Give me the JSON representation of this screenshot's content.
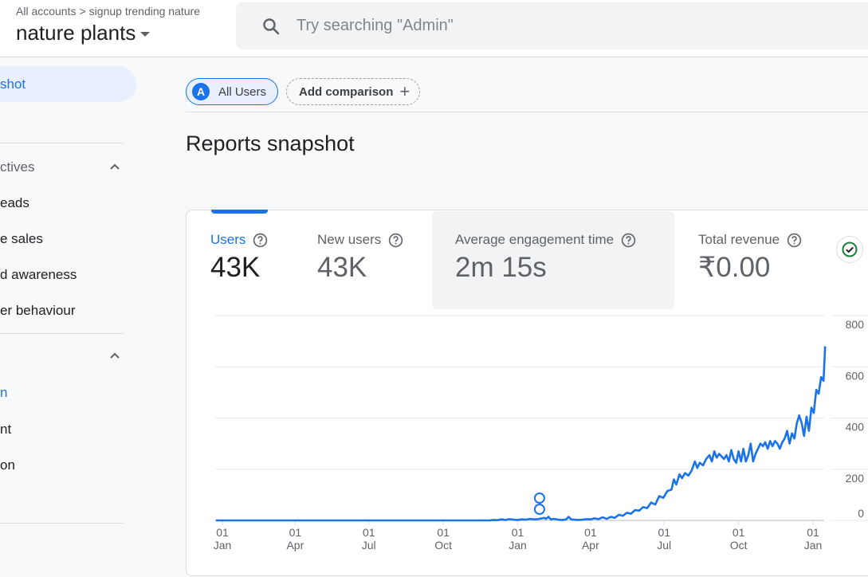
{
  "header": {
    "breadcrumb": [
      "All accounts",
      "signup trending nature"
    ],
    "breadcrumb_separator": ">",
    "property_name": "nature plants",
    "search_placeholder": "Try searching \"Admin\""
  },
  "sidebar": {
    "active_item": "shot",
    "sections": [
      {
        "title": "ctives",
        "expanded": true,
        "items": [
          "eads",
          "e sales",
          "d awareness",
          "er behaviour"
        ]
      },
      {
        "title": "",
        "expanded": true,
        "items": [
          "n",
          "nt",
          "on"
        ]
      }
    ]
  },
  "main": {
    "comparison": {
      "segment_avatar": "A",
      "segment_label": "All Users",
      "add_label": "Add comparison"
    },
    "title": "Reports snapshot",
    "metrics": [
      {
        "label": "Users",
        "value": "43K",
        "state": "active"
      },
      {
        "label": "New users",
        "value": "43K",
        "state": "normal"
      },
      {
        "label": "Average engagement time",
        "value": "2m 15s",
        "state": "hover"
      },
      {
        "label": "Total revenue",
        "value": "₹0.00",
        "state": "normal"
      }
    ],
    "colors": {
      "accent": "#1a73e8",
      "check": "#188038"
    }
  },
  "chart_data": {
    "type": "line",
    "title": "",
    "xlabel": "",
    "ylabel": "Users",
    "ylim": [
      0,
      800
    ],
    "y_ticks": [
      "800",
      "600",
      "400",
      "200",
      "0"
    ],
    "y_tick_values": [
      800,
      600,
      400,
      200,
      0
    ],
    "x_ticks": [
      {
        "day": "01",
        "month": "Jan",
        "day_index": 0
      },
      {
        "day": "01",
        "month": "Apr",
        "day_index": 90
      },
      {
        "day": "01",
        "month": "Jul",
        "day_index": 181
      },
      {
        "day": "01",
        "month": "Oct",
        "day_index": 273
      },
      {
        "day": "01",
        "month": "Jan",
        "day_index": 365
      },
      {
        "day": "01",
        "month": "Apr",
        "day_index": 455
      },
      {
        "day": "01",
        "month": "Jul",
        "day_index": 546
      },
      {
        "day": "01",
        "month": "Oct",
        "day_index": 638
      },
      {
        "day": "01",
        "month": "Jan",
        "day_index": 730
      }
    ],
    "x_range_days": [
      -8,
      750
    ],
    "grid": true,
    "series": [
      {
        "name": "Users",
        "color": "#1a73e8",
        "points_day_value": [
          [
            -8,
            0
          ],
          [
            0,
            0
          ],
          [
            30,
            0
          ],
          [
            60,
            0
          ],
          [
            90,
            0
          ],
          [
            120,
            0
          ],
          [
            150,
            0
          ],
          [
            181,
            0
          ],
          [
            210,
            0
          ],
          [
            240,
            0
          ],
          [
            273,
            0
          ],
          [
            300,
            0
          ],
          [
            330,
            0
          ],
          [
            335,
            2
          ],
          [
            340,
            1
          ],
          [
            345,
            4
          ],
          [
            350,
            2
          ],
          [
            355,
            5
          ],
          [
            360,
            3
          ],
          [
            365,
            2
          ],
          [
            370,
            4
          ],
          [
            375,
            3
          ],
          [
            380,
            6
          ],
          [
            385,
            4
          ],
          [
            390,
            5
          ],
          [
            395,
            8
          ],
          [
            398,
            10
          ],
          [
            400,
            6
          ],
          [
            403,
            14
          ],
          [
            406,
            4
          ],
          [
            410,
            6
          ],
          [
            415,
            3
          ],
          [
            420,
            2
          ],
          [
            425,
            4
          ],
          [
            428,
            14
          ],
          [
            431,
            4
          ],
          [
            435,
            3
          ],
          [
            440,
            2
          ],
          [
            445,
            3
          ],
          [
            450,
            5
          ],
          [
            455,
            4
          ],
          [
            460,
            8
          ],
          [
            465,
            5
          ],
          [
            470,
            12
          ],
          [
            475,
            6
          ],
          [
            480,
            14
          ],
          [
            485,
            10
          ],
          [
            490,
            22
          ],
          [
            495,
            18
          ],
          [
            500,
            30
          ],
          [
            505,
            26
          ],
          [
            510,
            40
          ],
          [
            515,
            38
          ],
          [
            520,
            52
          ],
          [
            525,
            48
          ],
          [
            530,
            70
          ],
          [
            535,
            62
          ],
          [
            540,
            95
          ],
          [
            545,
            88
          ],
          [
            550,
            115
          ],
          [
            555,
            120
          ],
          [
            558,
            160
          ],
          [
            561,
            140
          ],
          [
            565,
            180
          ],
          [
            568,
            165
          ],
          [
            572,
            185
          ],
          [
            576,
            175
          ],
          [
            580,
            195
          ],
          [
            584,
            230
          ],
          [
            587,
            205
          ],
          [
            590,
            225
          ],
          [
            594,
            215
          ],
          [
            598,
            240
          ],
          [
            602,
            255
          ],
          [
            605,
            230
          ],
          [
            608,
            270
          ],
          [
            611,
            245
          ],
          [
            614,
            260
          ],
          [
            617,
            250
          ],
          [
            620,
            240
          ],
          [
            623,
            255
          ],
          [
            626,
            230
          ],
          [
            629,
            275
          ],
          [
            632,
            240
          ],
          [
            635,
            225
          ],
          [
            638,
            270
          ],
          [
            641,
            230
          ],
          [
            644,
            280
          ],
          [
            647,
            230
          ],
          [
            650,
            255
          ],
          [
            653,
            300
          ],
          [
            656,
            230
          ],
          [
            659,
            260
          ],
          [
            662,
            280
          ],
          [
            665,
            300
          ],
          [
            668,
            290
          ],
          [
            671,
            305
          ],
          [
            674,
            280
          ],
          [
            677,
            310
          ],
          [
            680,
            290
          ],
          [
            683,
            310
          ],
          [
            686,
            300
          ],
          [
            689,
            280
          ],
          [
            692,
            305
          ],
          [
            695,
            320
          ],
          [
            698,
            350
          ],
          [
            701,
            300
          ],
          [
            704,
            340
          ],
          [
            707,
            320
          ],
          [
            710,
            380
          ],
          [
            713,
            410
          ],
          [
            716,
            380
          ],
          [
            719,
            330
          ],
          [
            722,
            405
          ],
          [
            725,
            350
          ],
          [
            728,
            440
          ],
          [
            731,
            420
          ],
          [
            734,
            510
          ],
          [
            737,
            495
          ],
          [
            740,
            560
          ],
          [
            743,
            545
          ],
          [
            745,
            680
          ]
        ]
      }
    ],
    "annotations": [
      {
        "type": "stacked-notes-marker",
        "day_index": 392,
        "count": 2
      }
    ]
  }
}
